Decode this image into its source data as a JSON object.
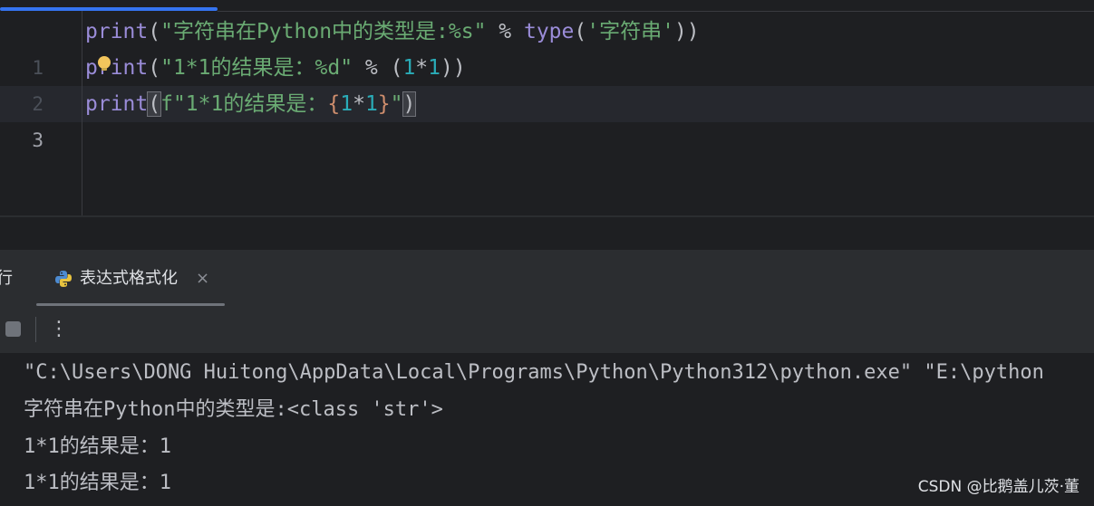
{
  "editor": {
    "line_numbers": [
      "1",
      "2",
      "3"
    ],
    "lines": [
      {
        "fn": "print",
        "open": "(",
        "str": "\"字符串在Python中的类型是:%s\"",
        "op": " % ",
        "fn2": "type",
        "open2": "(",
        "str2": "'字符串'",
        "close": "))"
      },
      {
        "fn": "print",
        "open": "(",
        "str": "\"1*1的结果是：%d\"",
        "op": " % (",
        "num1": "1",
        "mul": "*",
        "num2": "1",
        "close": "))"
      },
      {
        "fn": "print",
        "open": "(",
        "str_start": "f\"1*1的结果是：",
        "brace_open": "{",
        "num1": "1",
        "mul": "*",
        "num2": "1",
        "brace_close": "}",
        "str_end": "\"",
        "close": ")"
      }
    ],
    "colors": {
      "function": "#9a8cd8",
      "string": "#6aab73",
      "number": "#2aacb8",
      "punctuation": "#bcbec4",
      "brace": "#cf8e6d"
    }
  },
  "run_panel": {
    "label": "行",
    "tab": {
      "title": "表达式格式化",
      "icon": "python-icon",
      "close": "×"
    },
    "toolbar": {
      "stop_icon": "stop-icon",
      "more_label": "⋮"
    },
    "output": [
      "\"C:\\Users\\DONG Huitong\\AppData\\Local\\Programs\\Python\\Python312\\python.exe\" \"E:\\python",
      "字符串在Python中的类型是:<class 'str'>",
      "1*1的结果是：1",
      "1*1的结果是：1"
    ]
  },
  "watermark": "CSDN @比鹅盖儿茨·董"
}
